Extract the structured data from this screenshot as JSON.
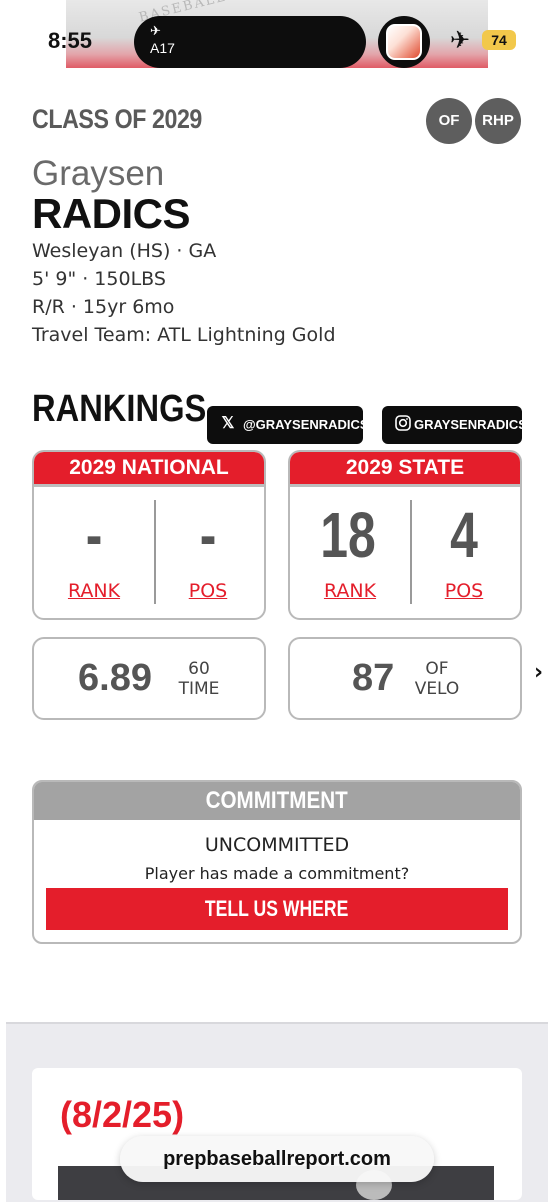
{
  "status_bar": {
    "time": "8:55",
    "island_label": "A17",
    "battery": "74"
  },
  "hero_text": "BASEBALL",
  "profile": {
    "class_of": "CLASS OF 2029",
    "positions": [
      "OF",
      "RHP"
    ],
    "first_name": "Graysen",
    "last_name": "RADICS",
    "school": "Wesleyan (HS) · GA",
    "size": "5' 9\" · 150LBS",
    "bats_throws_age": "R/R · 15yr 6mo",
    "travel_team": "Travel Team: ATL Lightning Gold"
  },
  "rankings": {
    "title": "RANKINGS",
    "social": {
      "x_handle": "@GRAYSENRADICS",
      "instagram_handle": "GRAYSENRADICS"
    },
    "national": {
      "title": "2029 NATIONAL",
      "rank_value": "-",
      "pos_value": "-",
      "rank_label": "RANK",
      "pos_label": "POS"
    },
    "state": {
      "title": "2029 STATE",
      "rank_value": "18",
      "pos_value": "4",
      "rank_label": "RANK",
      "pos_label": "POS"
    },
    "stats": [
      {
        "value": "6.89",
        "label_line1": "60",
        "label_line2": "TIME"
      },
      {
        "value": "87",
        "label_line1": "OF",
        "label_line2": "VELO"
      }
    ]
  },
  "commitment": {
    "title": "COMMITMENT",
    "status": "UNCOMMITTED",
    "question": "Player has made a commitment?",
    "button": "TELL US WHERE"
  },
  "news": {
    "date": "(8/2/25)"
  },
  "browser": {
    "url": "prepbaseballreport.com"
  },
  "colors": {
    "brand_red": "#e41e2b",
    "badge_gray": "#5e5e5e",
    "commit_header_gray": "#a3a3a3"
  }
}
